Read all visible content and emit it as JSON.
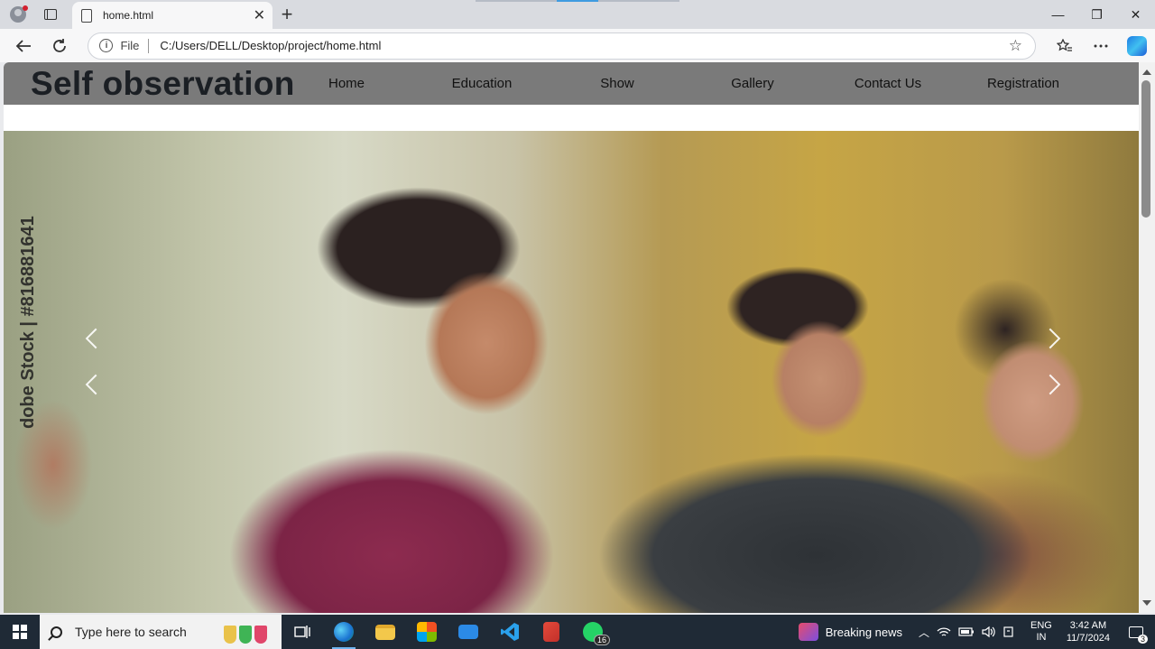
{
  "browser": {
    "tab_title": "home.html",
    "close_symbol": "✕",
    "new_tab_symbol": "+",
    "address": {
      "scheme_label": "File",
      "url": "C:/Users/DELL/Desktop/project/home.html"
    },
    "window_controls": {
      "minimize": "—",
      "maximize": "❐",
      "close": "✕"
    }
  },
  "site": {
    "brand": "Self observation",
    "menu": [
      "Home",
      "Education",
      "Show",
      "Gallery",
      "Contact Us",
      "Registration"
    ],
    "hero": {
      "watermark_line1": "dobe Stock | #816881641"
    }
  },
  "taskbar": {
    "search_placeholder": "Type here to search",
    "whatsapp_badge": "16",
    "news_label": "Breaking news",
    "lang_line1": "ENG",
    "lang_line2": "IN",
    "time": "3:42 AM",
    "date": "11/7/2024",
    "notification_count": "3"
  },
  "colors": {
    "site_nav_bg": "#7a7a7a",
    "taskbar_bg": "#1f2a36",
    "tabstrip_bg": "#d9dbe0"
  }
}
